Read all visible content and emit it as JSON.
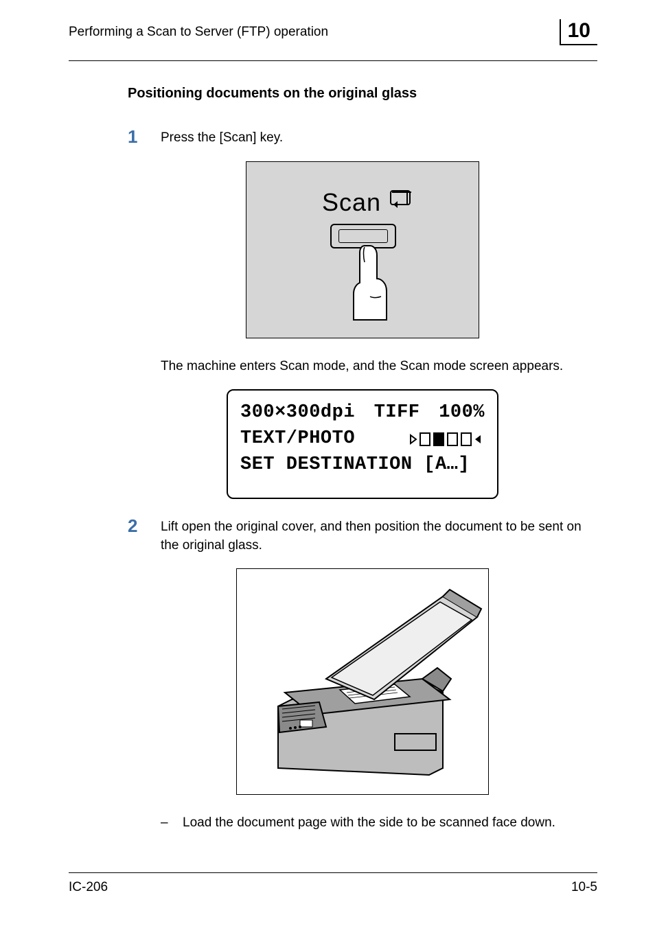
{
  "header": {
    "running_title": "Performing a Scan to Server (FTP) operation",
    "chapter_number": "10"
  },
  "section": {
    "heading": "Positioning documents on the original glass"
  },
  "steps": {
    "s1": {
      "num": "1",
      "text": "Press the [Scan] key."
    },
    "s1_after": "The machine enters Scan mode, and the Scan mode screen appears.",
    "s2": {
      "num": "2",
      "text": "Lift open the original cover, and then position the document to be sent on the original glass."
    },
    "s2_bullet": {
      "dash": "–",
      "text": "Load the document page with the side to be scanned face down."
    }
  },
  "figures": {
    "scan_key": {
      "label": "Scan"
    },
    "lcd": {
      "line1_left": "300×300dpi",
      "line1_mid": "TIFF",
      "line1_right": "100%",
      "line2_left": "TEXT/PHOTO",
      "line3": "SET DESTINATION [A…]"
    }
  },
  "footer": {
    "model": "IC-206",
    "pagenum": "10-5"
  }
}
